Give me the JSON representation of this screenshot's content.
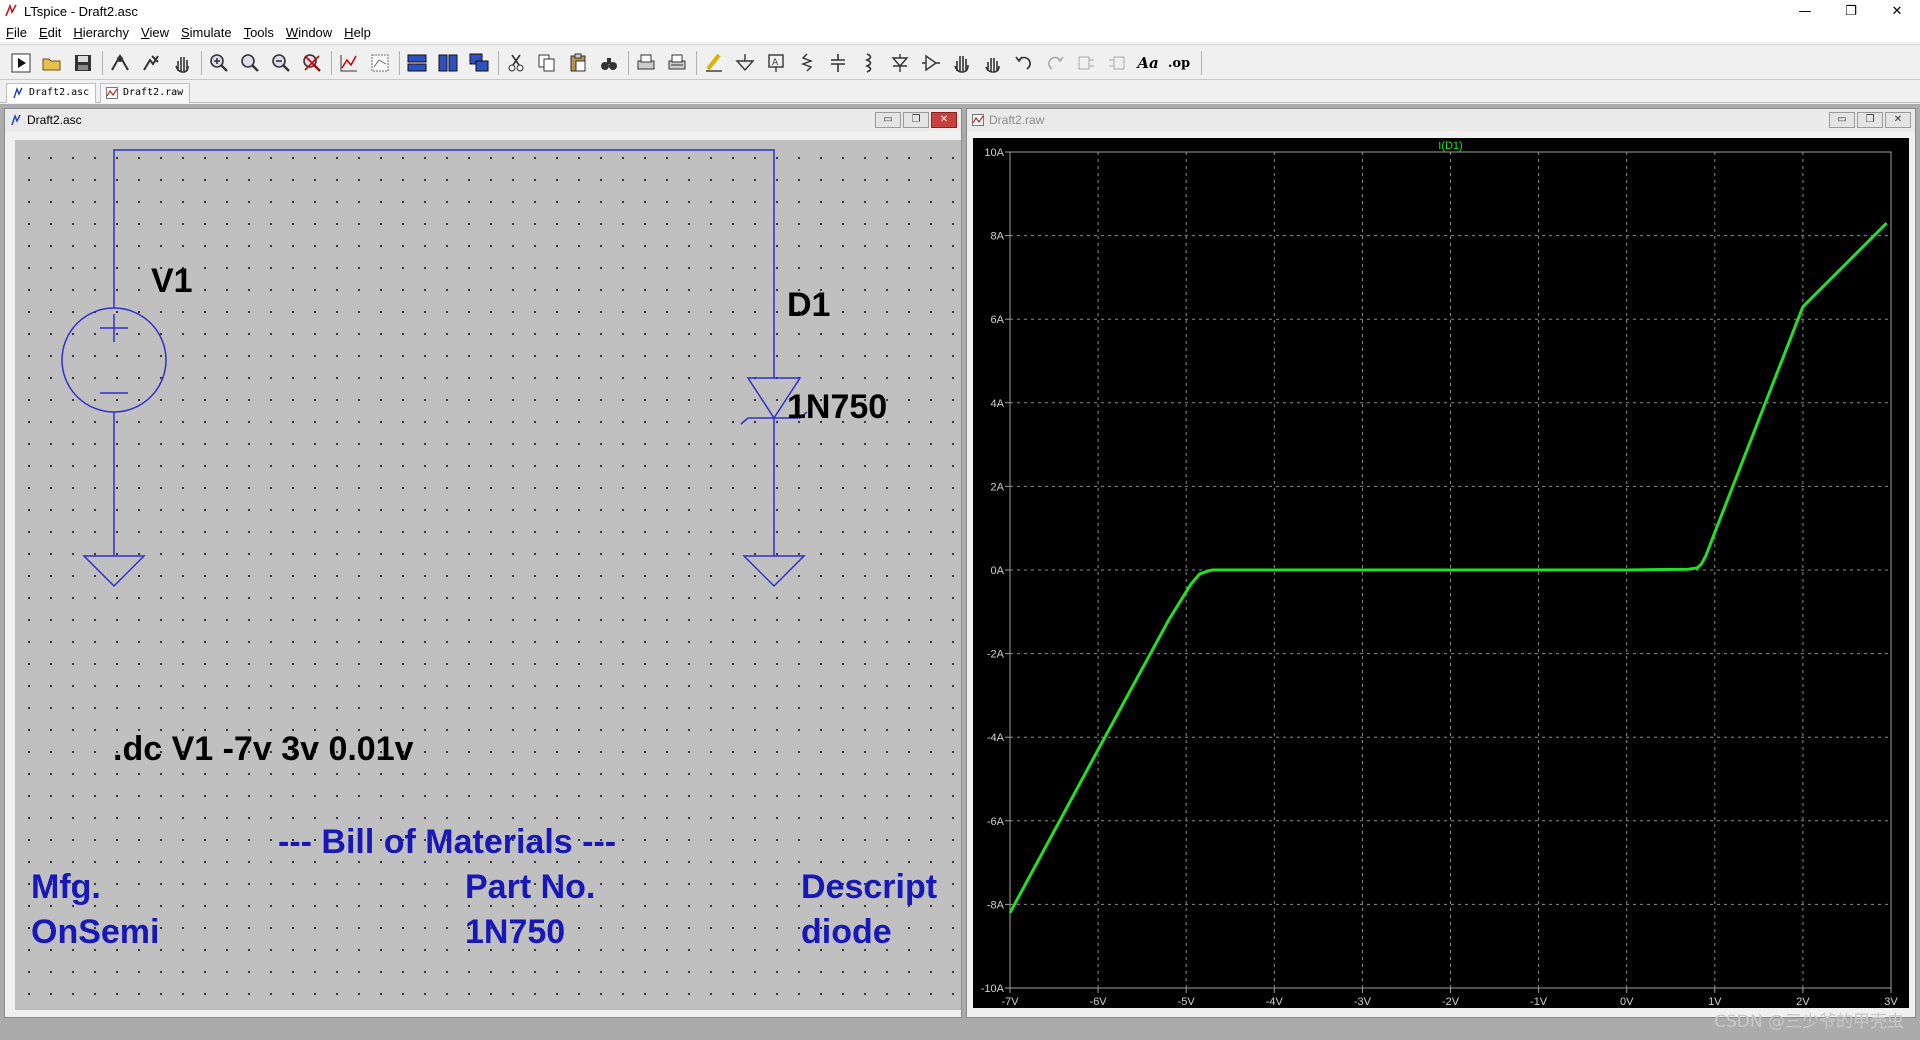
{
  "app": {
    "title": "LTspice - Draft2.asc"
  },
  "window_controls": {
    "minimize": "—",
    "maximize": "❐",
    "close": "✕"
  },
  "menu": [
    {
      "underline": "F",
      "rest": "ile"
    },
    {
      "underline": "E",
      "rest": "dit"
    },
    {
      "underline": "H",
      "rest": "ierarchy"
    },
    {
      "underline": "V",
      "rest": "iew"
    },
    {
      "underline": "S",
      "rest": "imulate"
    },
    {
      "underline": "T",
      "rest": "ools"
    },
    {
      "underline": "W",
      "rest": "indow"
    },
    {
      "underline": "H",
      "rest": "elp"
    }
  ],
  "toolbar": {
    "icons": [
      "run-icon",
      "open-icon",
      "save-icon",
      "control-panel-icon",
      "halt-icon",
      "pan-icon",
      "zoom-in-icon",
      "zoom-full-icon",
      "zoom-out-icon",
      "zoom-cancel-icon",
      "autorange-icon",
      "delete-traces-icon",
      "tile-horizontal-icon",
      "tile-vertical-icon",
      "cascade-icon",
      "cut-icon",
      "copy-icon",
      "paste-icon",
      "find-icon",
      "print-icon",
      "print-preview-icon",
      "draw-wire-icon",
      "ground-icon",
      "label-net-icon",
      "resistor-icon",
      "capacitor-icon",
      "inductor-icon",
      "diode-icon",
      "component-icon",
      "move-icon",
      "drag-icon",
      "undo-icon",
      "redo-icon",
      "rotate-icon",
      "mirror-icon",
      "text-icon",
      "spice-directive-icon"
    ],
    "text_icon_label": "Aa",
    "directive_label": ".op"
  },
  "tabs": [
    {
      "label": "Draft2.asc",
      "icon": "schematic-icon"
    },
    {
      "label": "Draft2.raw",
      "icon": "waveform-icon"
    }
  ],
  "schematic_window": {
    "title": "Draft2.asc",
    "source_name": "V1",
    "diode_name": "D1",
    "diode_value": "1N750",
    "directive": ".dc V1 -7v 3v 0.01v",
    "bom_title": "--- Bill of Materials ---",
    "bom_headers": [
      "Mfg.",
      "Part No.",
      "Descript"
    ],
    "bom_row": [
      "OnSemi",
      "1N750",
      "diode"
    ],
    "colors": {
      "wire": "#3030c8",
      "text": "#000000",
      "bom": "#1818b8"
    }
  },
  "waveform_window": {
    "title": "Draft2.raw",
    "trace_label": "I(D1)"
  },
  "chart_data": {
    "type": "line",
    "title": "",
    "xlabel": "",
    "ylabel": "",
    "xlim": [
      -7,
      3
    ],
    "ylim": [
      -10,
      10
    ],
    "x_ticks": [
      "-7V",
      "-6V",
      "-5V",
      "-4V",
      "-3V",
      "-2V",
      "-1V",
      "0V",
      "1V",
      "2V",
      "3V"
    ],
    "x_tick_values": [
      -7,
      -6,
      -5,
      -4,
      -3,
      -2,
      -1,
      0,
      1,
      2,
      3
    ],
    "y_ticks": [
      "10A",
      "8A",
      "6A",
      "4A",
      "2A",
      "0A",
      "-2A",
      "-4A",
      "-6A",
      "-8A",
      "-10A"
    ],
    "y_tick_values": [
      10,
      8,
      6,
      4,
      2,
      0,
      -2,
      -4,
      -6,
      -8,
      -10
    ],
    "grid": true,
    "background": "#000000",
    "series": [
      {
        "name": "I(D1)",
        "color": "#22e022",
        "x": [
          -7,
          -6,
          -5.2,
          -4.95,
          -4.85,
          -4.75,
          -4.7,
          0,
          0.7,
          0.8,
          0.85,
          0.9,
          1.0,
          2.0,
          2.95
        ],
        "y": [
          -8.2,
          -4.3,
          -1.2,
          -0.35,
          -0.1,
          -0.02,
          0,
          0,
          0.02,
          0.05,
          0.15,
          0.35,
          0.9,
          6.3,
          8.3
        ]
      }
    ]
  },
  "watermark": "CSDN @三少爷的甲壳虫"
}
